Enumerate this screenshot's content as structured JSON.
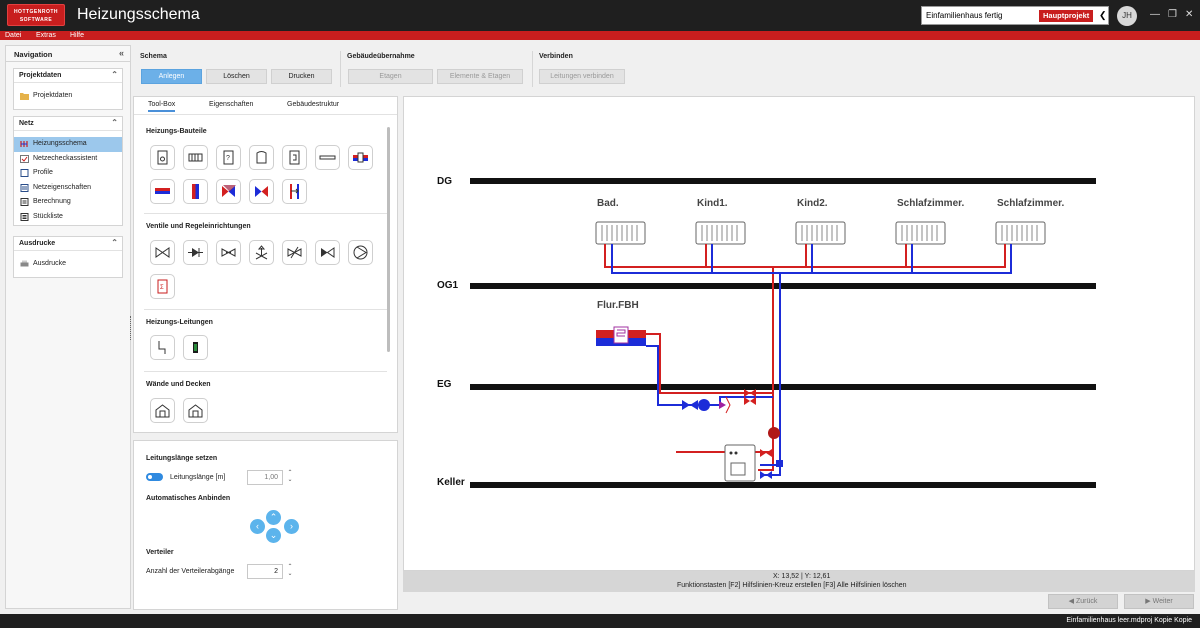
{
  "app": {
    "logo_text": "HOTTGENROTH SOFTWARE",
    "title": "Heizungsschema",
    "project_name": "Einfamilienhaus fertig",
    "project_badge": "Hauptprojekt",
    "user_initials": "JH"
  },
  "menu": [
    "Datei",
    "Extras",
    "Hilfe"
  ],
  "navigation": {
    "title": "Navigation",
    "sections": [
      {
        "title": "Projektdaten",
        "items": [
          {
            "label": "Projektdaten",
            "selected": false
          }
        ]
      },
      {
        "title": "Netz",
        "items": [
          {
            "label": "Heizungsschema",
            "selected": true
          },
          {
            "label": "Netzecheckassistent",
            "selected": false
          },
          {
            "label": "Profile",
            "selected": false
          },
          {
            "label": "Netzeigenschaften",
            "selected": false
          },
          {
            "label": "Berechnung",
            "selected": false
          },
          {
            "label": "Stückliste",
            "selected": false
          }
        ]
      },
      {
        "title": "Ausdrucke",
        "items": [
          {
            "label": "Ausdrucke",
            "selected": false
          }
        ]
      }
    ]
  },
  "ribbon": {
    "schema": {
      "title": "Schema",
      "buttons": [
        "Anlegen",
        "Löschen",
        "Drucken"
      ]
    },
    "gebaeude": {
      "title": "Gebäudeübernahme",
      "buttons": [
        "Etagen",
        "Elemente & Etagen"
      ]
    },
    "verbinden": {
      "title": "Verbinden",
      "buttons": [
        "Leitungen verbinden"
      ]
    }
  },
  "toolbox": {
    "tabs": [
      "Tool-Box",
      "Eigenschaften",
      "Gebäudestruktur"
    ],
    "active_tab": "Tool-Box",
    "sections": {
      "bauteile": "Heizungs-Bauteile",
      "ventile": "Ventile und Regeleinrichtungen",
      "leitungen": "Heizungs-Leitungen",
      "waende": "Wände und Decken"
    }
  },
  "settings": {
    "leitungslaenge_title": "Leitungslänge setzen",
    "leitungslaenge_label": "Leitungslänge [m]",
    "leitungslaenge_value": "1,00",
    "anbinden_title": "Automatisches Anbinden",
    "verteiler_title": "Verteiler",
    "verteiler_label": "Anzahl der Verteilerabgänge",
    "verteiler_value": "2"
  },
  "schema": {
    "floors": [
      "DG",
      "OG1",
      "EG",
      "Keller"
    ],
    "radiators": [
      "Bad.",
      "Kind1.",
      "Kind2.",
      "Schlafzimmer.",
      "Schlafzimmer."
    ],
    "fbh_label": "Flur.FBH",
    "colors": {
      "supply": "#d32020",
      "return": "#1c2cd8",
      "floor": "#111111"
    }
  },
  "status": {
    "coords": "X: 13,52 | Y: 12,61",
    "keys": "Funktionstasten    [F2] Hilfslinien-Kreuz erstellen    [F3] Alle Hilfslinien löschen"
  },
  "footer_nav": {
    "back": "Zurück",
    "next": "Weiter"
  },
  "footer_file": "Einfamilienhaus leer.mdproj Kopie Kopie"
}
